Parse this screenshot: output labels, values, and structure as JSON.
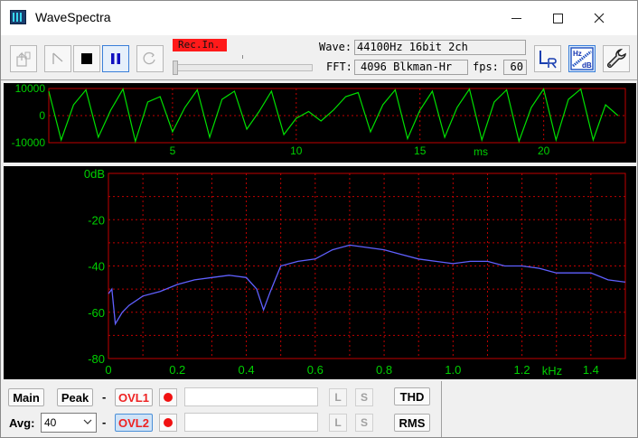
{
  "window": {
    "title": "WaveSpectra"
  },
  "toolbar": {
    "rec_indicator": "Rec.In.",
    "wave_label": "Wave:",
    "wave_value": "44100Hz 16bit 2ch",
    "fft_label": "FFT:",
    "fft_value": "4096 Blkman-Hr",
    "fps_label": "fps:",
    "fps_value": "60",
    "buttons": [
      "open-file",
      "play",
      "stop",
      "pause",
      "loop",
      "channel-lr",
      "scale-hz-db",
      "settings"
    ]
  },
  "waveform": {
    "y_ticks": [
      "10000",
      "0",
      "-10000"
    ],
    "x_ticks": [
      "5",
      "10",
      "15",
      "20"
    ],
    "x_unit": "ms",
    "line_color": "#00e000",
    "grid_color": "#c00000"
  },
  "spectrum": {
    "y_ticks": [
      "0dB",
      "-20",
      "-40",
      "-60",
      "-80"
    ],
    "x_ticks": [
      "0",
      "0.2",
      "0.4",
      "0.6",
      "0.8",
      "1.0",
      "1.2",
      "1.4"
    ],
    "x_unit": "kHz",
    "line_color": "#6060ff"
  },
  "chart_data": [
    {
      "type": "line",
      "xlabel": "ms",
      "ylabel": "",
      "xlim": [
        0,
        23.3
      ],
      "ylim": [
        -10000,
        10000
      ],
      "x_ticks": [
        5,
        10,
        15,
        20
      ],
      "y_ticks": [
        10000,
        0,
        -10000
      ],
      "grid": true,
      "series": [
        {
          "x": [
            0,
            0.5,
            1.0,
            1.5,
            2.0,
            2.5,
            3.0,
            3.5,
            4.0,
            4.5,
            5.0,
            5.5,
            6.0,
            6.5,
            7.0,
            7.5,
            8.0,
            8.5,
            9.0,
            9.5,
            10.0,
            10.5,
            11.0,
            11.5,
            12.0,
            12.5,
            13.0,
            13.5,
            14.0,
            14.5,
            15.0,
            15.5,
            16.0,
            16.5,
            17.0,
            17.5,
            18.0,
            18.5,
            19.0,
            19.5,
            20.0,
            20.5,
            21.0,
            21.5,
            22.0,
            22.5,
            23.0
          ],
          "values": [
            9000,
            -9000,
            4000,
            9500,
            -8000,
            2000,
            9800,
            -9500,
            5000,
            7000,
            -6000,
            3000,
            9500,
            -8000,
            6000,
            9000,
            -5000,
            1500,
            9000,
            -7000,
            -1000,
            1500,
            -2000,
            2000,
            7000,
            8500,
            -6000,
            4000,
            9500,
            -8500,
            2000,
            9000,
            -8000,
            3000,
            9800,
            -9000,
            5000,
            9500,
            -9500,
            3000,
            9800,
            -9000,
            6000,
            9800,
            -9000,
            4000,
            0
          ]
        }
      ]
    },
    {
      "type": "line",
      "xlabel": "kHz",
      "ylabel": "",
      "xlim": [
        0,
        1.5
      ],
      "ylim": [
        -80,
        0
      ],
      "x_ticks": [
        0,
        0.2,
        0.4,
        0.6,
        0.8,
        1.0,
        1.2,
        1.4
      ],
      "y_ticks": [
        0,
        -20,
        -40,
        -60,
        -80
      ],
      "grid": true,
      "series": [
        {
          "x": [
            0,
            0.01,
            0.02,
            0.04,
            0.06,
            0.1,
            0.15,
            0.2,
            0.25,
            0.3,
            0.35,
            0.4,
            0.43,
            0.45,
            0.47,
            0.5,
            0.55,
            0.6,
            0.65,
            0.7,
            0.75,
            0.8,
            0.85,
            0.9,
            0.95,
            1.0,
            1.05,
            1.1,
            1.15,
            1.2,
            1.25,
            1.3,
            1.35,
            1.4,
            1.45,
            1.5
          ],
          "values": [
            -52,
            -50,
            -65,
            -60,
            -57,
            -53,
            -51,
            -48,
            -46,
            -45,
            -44,
            -45,
            -50,
            -59,
            -51,
            -40,
            -38,
            -37,
            -33,
            -31,
            -32,
            -33,
            -35,
            -37,
            -38,
            -39,
            -38,
            -38,
            -40,
            -40,
            -41,
            -43,
            -43,
            -43,
            -46,
            -47
          ]
        }
      ]
    }
  ],
  "bottom": {
    "main_label": "Main",
    "peak_label": "Peak",
    "dash": "-",
    "ovl1_label": "OVL1",
    "ovl2_label": "OVL2",
    "avg_label": "Avg:",
    "avg_value": "40",
    "l_label": "L",
    "s_label": "S",
    "thd_label": "THD",
    "rms_label": "RMS"
  }
}
